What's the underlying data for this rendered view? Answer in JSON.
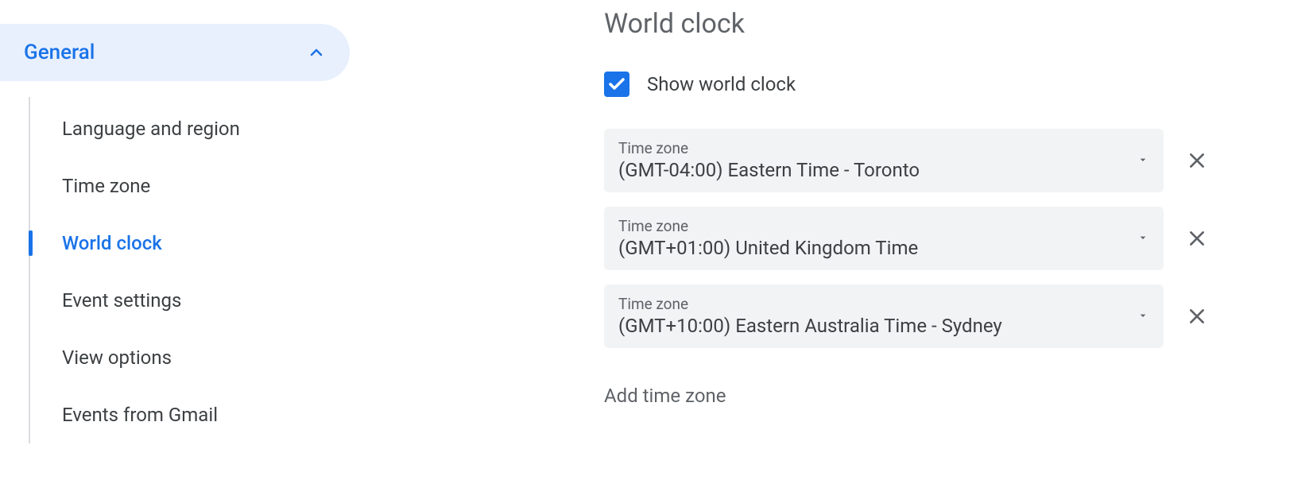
{
  "sidebar": {
    "header": "General",
    "items": [
      {
        "label": "Language and region",
        "active": false
      },
      {
        "label": "Time zone",
        "active": false
      },
      {
        "label": "World clock",
        "active": true
      },
      {
        "label": "Event settings",
        "active": false
      },
      {
        "label": "View options",
        "active": false
      },
      {
        "label": "Events from Gmail",
        "active": false
      }
    ]
  },
  "main": {
    "title": "World clock",
    "checkbox_label": "Show world clock",
    "checkbox_checked": true,
    "tz_field_label": "Time zone",
    "timezones": [
      {
        "value": "(GMT-04:00) Eastern Time - Toronto"
      },
      {
        "value": "(GMT+01:00) United Kingdom Time"
      },
      {
        "value": "(GMT+10:00) Eastern Australia Time - Sydney"
      }
    ],
    "add_label": "Add time zone"
  }
}
